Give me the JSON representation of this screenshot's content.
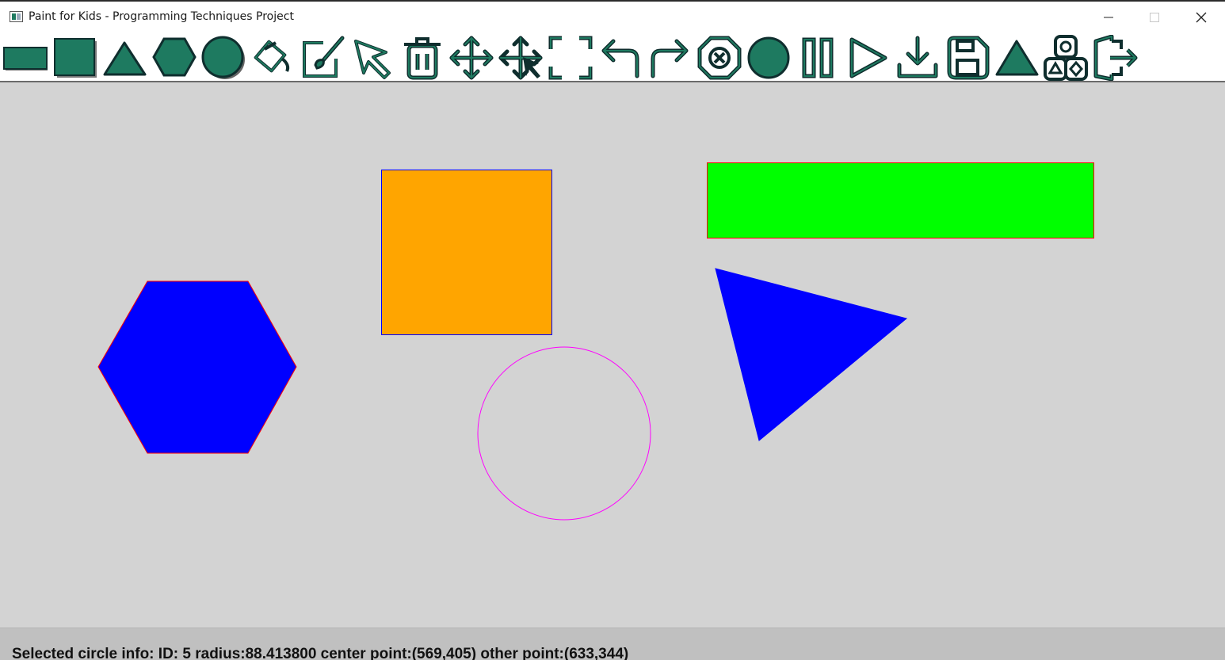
{
  "window": {
    "title": "Paint for Kids - Programming Techniques Project",
    "controls": [
      "minimize",
      "maximize",
      "close"
    ]
  },
  "toolbar": {
    "icon_color": "#1e7a60",
    "outline_color": "#0f2e2e",
    "items": [
      {
        "name": "rectangle-tool",
        "icon": "rectangle-icon"
      },
      {
        "name": "square-tool",
        "icon": "square-icon"
      },
      {
        "name": "triangle-tool",
        "icon": "triangle-icon"
      },
      {
        "name": "hexagon-tool",
        "icon": "hexagon-icon"
      },
      {
        "name": "circle-tool",
        "icon": "circle-icon"
      },
      {
        "name": "fill-color-tool",
        "icon": "paint-bucket-icon"
      },
      {
        "name": "draw-color-tool",
        "icon": "brush-icon"
      },
      {
        "name": "select-tool",
        "icon": "cursor-arrow-icon"
      },
      {
        "name": "delete-tool",
        "icon": "trash-icon"
      },
      {
        "name": "move-tool",
        "icon": "move-arrows-icon"
      },
      {
        "name": "drag-move-tool",
        "icon": "move-cursor-icon"
      },
      {
        "name": "resize-tool",
        "icon": "resize-brackets-icon"
      },
      {
        "name": "undo-tool",
        "icon": "undo-icon"
      },
      {
        "name": "redo-tool",
        "icon": "redo-icon"
      },
      {
        "name": "clear-all-tool",
        "icon": "stop-x-icon"
      },
      {
        "name": "record-tool",
        "icon": "record-circle-icon"
      },
      {
        "name": "pause-tool",
        "icon": "pause-icon"
      },
      {
        "name": "play-tool",
        "icon": "play-icon"
      },
      {
        "name": "load-tool",
        "icon": "download-icon"
      },
      {
        "name": "save-tool",
        "icon": "floppy-disk-icon"
      },
      {
        "name": "switch-mode-tool",
        "icon": "triangle-filled-icon"
      },
      {
        "name": "shapes-game-tool",
        "icon": "shapes-icon"
      },
      {
        "name": "exit-tool",
        "icon": "exit-door-icon"
      }
    ]
  },
  "canvas": {
    "background": "#d3d3d3",
    "shapes": [
      {
        "type": "hexagon",
        "fill": "#0000ff",
        "stroke": "#ff0000"
      },
      {
        "type": "square",
        "fill": "#ffa500",
        "stroke": "#0000ff"
      },
      {
        "type": "rectangle",
        "fill": "#00ff00",
        "stroke": "#ff0000"
      },
      {
        "type": "triangle",
        "fill": "#0000ff",
        "stroke": "#0000ff"
      },
      {
        "type": "circle",
        "fill": "none",
        "stroke": "#ff00ff"
      }
    ]
  },
  "status": {
    "text": "Selected circle info: ID: 5 radius:88.413800 center point:(569,405) other point:(633,344)"
  }
}
